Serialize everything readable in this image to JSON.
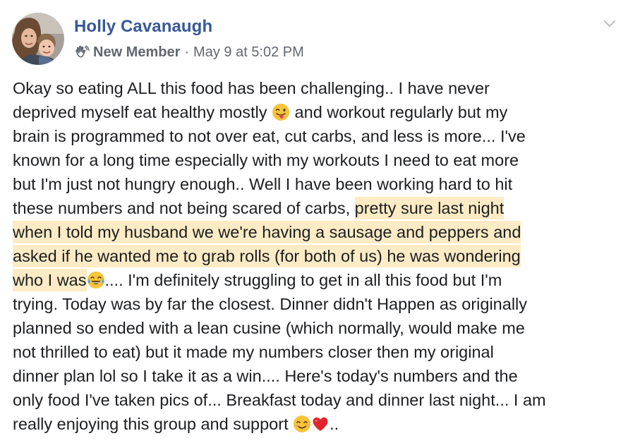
{
  "post": {
    "author": "Holly Cavanaugh",
    "badge_icon": "waving-hand-icon",
    "role": "New Member",
    "separator": "·",
    "timestamp": "May 9 at 5:02 PM",
    "menu_icon": "chevron-down-icon",
    "highlight_color": "#fcebc4",
    "author_color": "#385898",
    "lines": [
      {
        "a": "Okay so eating ALL this food has been challenging.. I have never"
      },
      {
        "a": "deprived myself eat healthy mostly ",
        "emoji": "winking-tongue-emoji",
        "b": " and workout regularly but my"
      },
      {
        "a": "brain is programmed to not over eat, cut carbs, and less is more... I've"
      },
      {
        "a": "known for a long time especially with my workouts I need to eat more"
      },
      {
        "a": "but I'm just not hungry enough.. Well I have been working hard to hit"
      },
      {
        "a": "these numbers and not being scared of carbs, ",
        "h": "pretty sure last night"
      },
      {
        "h": "when I told my husband we we're having a sausage and peppers and"
      },
      {
        "h": "asked if he wanted me to grab rolls (for both of us) he was wondering"
      },
      {
        "h": "who I was",
        "emoji": "tears-of-joy-emoji",
        "b": ".... I'm definitely struggling to get in all this food but I'm"
      },
      {
        "a": "trying. Today was by far the closest. Dinner didn't Happen as originally"
      },
      {
        "a": "planned so ended with a lean cusine (which normally, would make me"
      },
      {
        "a": "not thrilled to eat) but it made my numbers closer then my original"
      },
      {
        "a": "dinner plan lol so I take it as a win.... Here's today's numbers and the"
      },
      {
        "a": "only food I've taken pics of... Breakfast today and dinner last night... I am"
      },
      {
        "a": "really enjoying this group and support ",
        "emoji": "smiling-face-emoji",
        "emoji2": "red-heart-emoji",
        "b": ".."
      }
    ]
  }
}
